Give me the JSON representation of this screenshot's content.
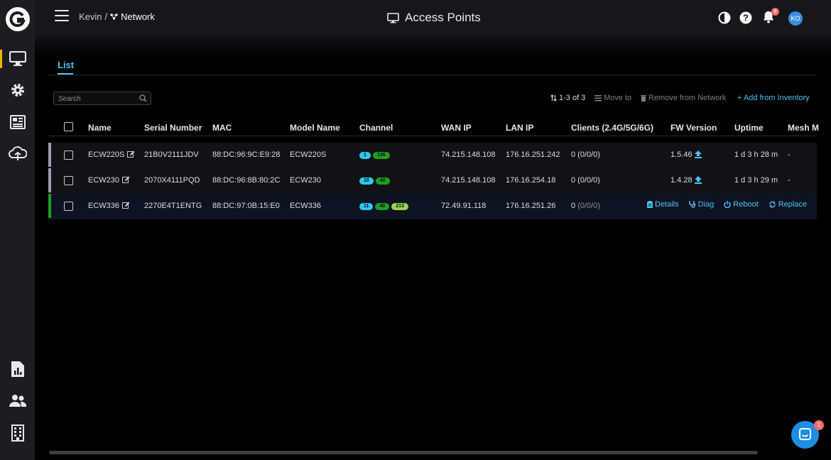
{
  "header": {
    "breadcrumb_user": "Kevin",
    "breadcrumb_sep": "/",
    "breadcrumb_network": "Network",
    "page_title": "Access Points",
    "notification_count": "8",
    "avatar_initials": "KO"
  },
  "sidebar": {
    "items": [
      "desktop-icon",
      "gear-icon",
      "newspaper-icon",
      "cloud-sync-icon",
      "report-icon",
      "users-icon",
      "building-icon"
    ],
    "active_color": "#f2b400"
  },
  "tabs": {
    "list_label": "List"
  },
  "search": {
    "placeholder": "Search",
    "value": ""
  },
  "toolbar": {
    "count": "1-3 of 3",
    "move_to": "Move to",
    "remove": "Remove from Network",
    "add": "+ Add from Inventory"
  },
  "table": {
    "columns": [
      "Name",
      "Serial Number",
      "MAC",
      "Model Name",
      "Channel",
      "WAN IP",
      "LAN IP",
      "Clients (2.4G/5G/6G)",
      "FW Version",
      "Uptime",
      "Mesh M"
    ],
    "rows": [
      {
        "name": "ECW220S",
        "serial": "21B0V2111JDV",
        "mac": "88:DC:96:9C:E9:28",
        "model": "ECW220S",
        "ch24": "1",
        "ch5": "136",
        "ch6": "",
        "wan": "74.215.148.108",
        "lan": "176.16.251.242",
        "clients": "0 (0/0/0)",
        "fw": "1.5.46",
        "uptime": "1 d 3 h 28 m",
        "mesh": "-",
        "status_color": "#9aa1ab"
      },
      {
        "name": "ECW230",
        "serial": "2070X4111PQD",
        "mac": "88:DC:96:8B:80:2C",
        "model": "ECW230",
        "ch24": "10",
        "ch5": "40",
        "ch6": "",
        "wan": "74.215.148.108",
        "lan": "176.16.254.18",
        "clients": "0 (0/0/0)",
        "fw": "1.4.28",
        "uptime": "1 d 3 h 29 m",
        "mesh": "-",
        "status_color": "#9aa1ab"
      },
      {
        "name": "ECW336",
        "serial": "2270E4T1ENTG",
        "mac": "88:DC:97:0B:15:E0",
        "model": "ECW336",
        "ch24": "11",
        "ch5": "40",
        "ch6": "213",
        "wan": "72.49.91.118",
        "lan": "176.16.251.26",
        "clients_count": "0",
        "clients_detail": "(0/0/0)",
        "status_color": "#1f9e25"
      }
    ],
    "row_actions": [
      "Details",
      "Diag",
      "Reboot",
      "Replace"
    ]
  },
  "chat": {
    "badge": "1"
  },
  "colors": {
    "accent": "#4fc3f7",
    "channel_24": "#2ec8f0",
    "channel_5": "#1f9e25",
    "channel_6": "#9ad34a"
  }
}
